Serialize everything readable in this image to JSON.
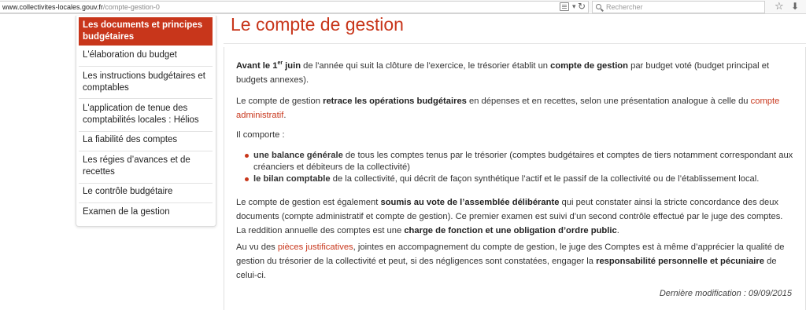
{
  "browser": {
    "url_host": "www.collectivites-locales.gouv.fr",
    "url_path": "/compte-gestion-0",
    "search_placeholder": "Rechercher"
  },
  "sidebar": {
    "items": [
      {
        "label": "Les documents et principes budgétaires",
        "active": true
      },
      {
        "label": "L'élaboration du budget"
      },
      {
        "label": "Les instructions budgétaires et comptables"
      },
      {
        "label": "L'application de tenue des comptabilités locales : Hélios"
      },
      {
        "label": "La fiabilité des comptes"
      },
      {
        "label": "Les régies d’avances et de recettes"
      },
      {
        "label": "Le contrôle budgétaire"
      },
      {
        "label": "Examen de la gestion"
      }
    ]
  },
  "main": {
    "title": "Le compte de gestion",
    "p1": {
      "bold_avant": "Avant le 1",
      "sup": "er",
      "bold_juin": " juin",
      "t1": " de l'année qui suit la clôture de l'exercice, le trésorier établit un ",
      "bold_compte": "compte de gestion",
      "t2": " par budget voté (budget principal et budgets annexes)."
    },
    "p2": {
      "t1": "Le compte de gestion ",
      "bold": "retrace les opérations budgétaires",
      "t2": " en dépenses et en recettes, selon une présentation analogue à celle du ",
      "link": "compte administratif",
      "t3": "."
    },
    "p3": "Il comporte  :",
    "bullets": [
      {
        "bold": "une balance générale",
        "text": " de tous les comptes tenus par le trésorier (comptes budgétaires et comptes de tiers notamment correspondant aux créanciers et débiteurs de la collectivité)"
      },
      {
        "bold": "le bilan comptable",
        "text": " de la collectivité, qui décrit de façon synthétique l’actif et le passif de la collectivité ou de l’établissement local."
      }
    ],
    "p4": {
      "t1": "Le compte de gestion est également ",
      "bold1": "soumis au vote de l’assemblée délibérante",
      "t2": " qui peut constater ainsi la stricte concordance des deux documents (compte administratif et compte de gestion). Ce premier examen est suivi d’un second contrôle effectué par le juge des comptes. La reddition annuelle des comptes est une ",
      "bold2": "charge de fonction et une obligation d’ordre public",
      "t3": "."
    },
    "p5": {
      "t1": "Au vu des ",
      "link": "pièces justificatives",
      "t2": ", jointes en accompagnement du compte de gestion, le juge des Comptes est à même d’apprécier la qualité de gestion du trésorier de la collectivité et peut, si des négligences sont constatées, engager la ",
      "bold": "responsabilité personnelle et pécuniaire",
      "t3": " de celui-ci."
    },
    "last_modified": "Dernière modification  : 09/09/2015"
  }
}
